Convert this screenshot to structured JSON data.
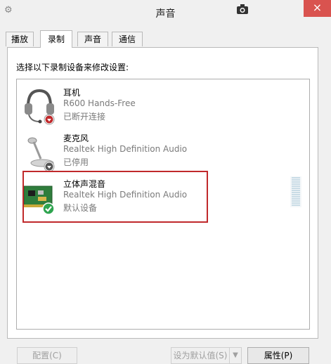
{
  "window": {
    "title": "声音",
    "close_glyph": "×"
  },
  "tabs": [
    {
      "label": "播放"
    },
    {
      "label": "录制"
    },
    {
      "label": "声音"
    },
    {
      "label": "通信"
    }
  ],
  "active_tab": "录制",
  "instruction": "选择以下录制设备来修改设置:",
  "devices": [
    {
      "name": "耳机",
      "description": "R600 Hands-Free",
      "status": "已断开连接",
      "icon": "headset-icon",
      "badge": "disconnected-badge"
    },
    {
      "name": "麦克风",
      "description": "Realtek High Definition Audio",
      "status": "已停用",
      "icon": "microphone-icon",
      "badge": "disabled-badge"
    },
    {
      "name": "立体声混音",
      "description": "Realtek High Definition Audio",
      "status": "默认设备",
      "icon": "sound-card-icon",
      "badge": "default-check-badge"
    }
  ],
  "buttons": {
    "configure": "配置(C)",
    "set_default": "设为默认值(S)",
    "properties": "属性(P)"
  },
  "colors": {
    "highlight": "#c0292b",
    "close": "#d9534f",
    "default_check": "#2ea44f"
  }
}
